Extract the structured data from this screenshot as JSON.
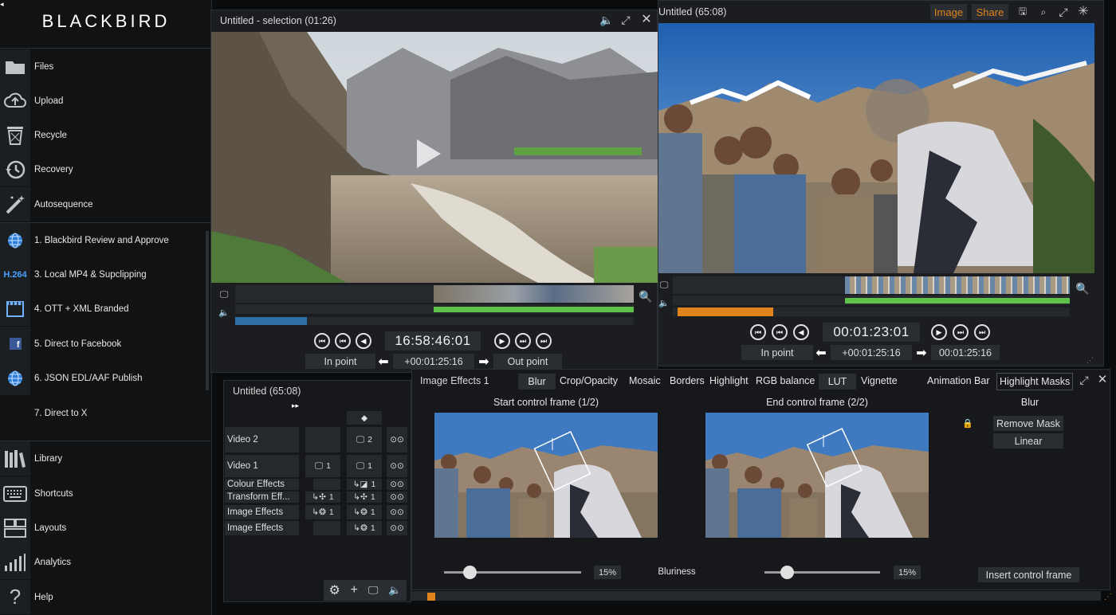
{
  "colors": {
    "accent_orange": "#e0851c",
    "audio_green": "#5fc24a",
    "progress_blue": "#2e6fa8",
    "panel_bg": "#1b1d20",
    "sidebar_bg": "#101214"
  },
  "sidebar": {
    "logo": "BLACKBIRD",
    "items": [
      {
        "label": "Files",
        "icon": "folder-icon"
      },
      {
        "label": "Upload",
        "icon": "cloud-upload-icon"
      },
      {
        "label": "Recycle",
        "icon": "recycle-bin-icon"
      },
      {
        "label": "Recovery",
        "icon": "history-icon"
      },
      {
        "label": "Autosequence",
        "icon": "magic-wand-icon"
      },
      {
        "label": "1. Blackbird Review and Approve",
        "icon": "globe-icon"
      },
      {
        "label": "3. Local MP4 & Supclipping",
        "icon": "h264-icon",
        "icon_text": "H.264"
      },
      {
        "label": "4. OTT + XML Branded",
        "icon": "film-icon"
      },
      {
        "label": "5. Direct to Facebook",
        "icon": "facebook-icon"
      },
      {
        "label": "6. JSON EDL/AAF Publish",
        "icon": "globe-icon"
      },
      {
        "label": "7. Direct to X",
        "icon": "blank-icon"
      },
      {
        "label": "Library",
        "icon": "library-icon"
      },
      {
        "label": "Shortcuts",
        "icon": "keyboard-icon"
      },
      {
        "label": "Layouts",
        "icon": "layouts-icon"
      },
      {
        "label": "Analytics",
        "icon": "analytics-icon"
      },
      {
        "label": "Help",
        "icon": "help-icon"
      }
    ]
  },
  "source_viewer": {
    "title": "Untitled - selection (01:26)",
    "timecode": "16:58:46:01",
    "in_point_label": "In point",
    "out_point_label": "Out point",
    "duration": "+00:01:25:16",
    "progress": 0.18
  },
  "record_viewer": {
    "title": "Untitled (65:08)",
    "image_label": "Image",
    "share_label": "Share",
    "timecode": "00:01:23:01",
    "in_point_label": "In point",
    "duration": "+00:01:25:16",
    "out_timecode": "00:01:25:16",
    "progress": 0.24
  },
  "timeline": {
    "title": "Untitled (65:08)",
    "tracks": [
      {
        "name": "Video 2",
        "count": "2"
      },
      {
        "name": "Video 1",
        "count": "1",
        "count_left": "1"
      },
      {
        "name": "Colour Effects",
        "count": "1"
      },
      {
        "name": "Transform Eff...",
        "count": "1",
        "count_left": "1"
      },
      {
        "name": "Image Effects",
        "count": "1",
        "count_left": "1"
      },
      {
        "name": "Image Effects",
        "count": "1"
      }
    ]
  },
  "effects": {
    "title": "Image Effects 1",
    "tabs": [
      "Blur",
      "Crop/Opacity",
      "Mosaic",
      "Borders",
      "Highlight",
      "RGB balance",
      "LUT",
      "Vignette",
      "Animation Bar",
      "Highlight Masks"
    ],
    "start_frame_label": "Start control frame (1/2)",
    "end_frame_label": "End control frame (2/2)",
    "blur_header": "Blur",
    "remove_mask_label": "Remove Mask",
    "linear_label": "Linear",
    "bluriness_label": "Bluriness",
    "start_value": "15%",
    "end_value": "15%",
    "start_slider": 0.15,
    "end_slider": 0.15,
    "insert_label": "Insert control frame"
  }
}
